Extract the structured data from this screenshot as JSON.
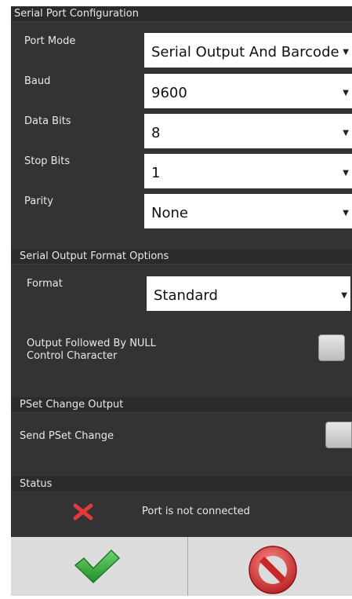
{
  "serial_port": {
    "section_title": "Serial Port Configuration",
    "port_mode": {
      "label": "Port Mode",
      "value": "Serial Output And Barcode"
    },
    "baud": {
      "label": "Baud",
      "value": "9600"
    },
    "data_bits": {
      "label": "Data Bits",
      "value": "8"
    },
    "stop_bits": {
      "label": "Stop Bits",
      "value": "1"
    },
    "parity": {
      "label": "Parity",
      "value": "None"
    }
  },
  "output_format": {
    "section_title": "Serial Output Format Options",
    "format": {
      "label": "Format",
      "value": "Standard"
    },
    "null_char": {
      "label_line1": "Output Followed By NULL",
      "label_line2": "Control Character",
      "checked": false
    }
  },
  "pset": {
    "section_title": "PSet Change Output",
    "send_pset": {
      "label": "Send PSet Change",
      "checked": false
    }
  },
  "status": {
    "section_title": "Status",
    "icon": "red-x-icon",
    "message": "Port is not connected"
  },
  "footer": {
    "ok_icon": "green-checkmark-icon",
    "cancel_icon": "red-no-entry-icon"
  },
  "colors": {
    "panel_bg": "#333333",
    "header_bg": "#2b2b2b",
    "text": "#e8e8e8",
    "ok_green": "#3cb43c",
    "cancel_red": "#d93030",
    "error_red": "#e03a3a"
  }
}
